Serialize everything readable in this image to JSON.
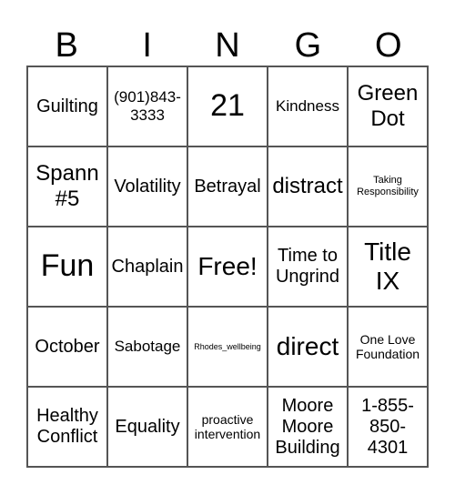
{
  "header": [
    "B",
    "I",
    "N",
    "G",
    "O"
  ],
  "cells": [
    {
      "text": "Guilting",
      "size": "s-m"
    },
    {
      "text": "(901)843-3333",
      "size": "s-sm"
    },
    {
      "text": "21",
      "size": "s-xl"
    },
    {
      "text": "Kindness",
      "size": "s-sm"
    },
    {
      "text": "Green Dot",
      "size": "s-ml"
    },
    {
      "text": "Spann #5",
      "size": "s-ml"
    },
    {
      "text": "Volatility",
      "size": "s-m"
    },
    {
      "text": "Betrayal",
      "size": "s-m"
    },
    {
      "text": "distract",
      "size": "s-ml"
    },
    {
      "text": "Taking Responsibility",
      "size": "s-xxs"
    },
    {
      "text": "Fun",
      "size": "s-xl"
    },
    {
      "text": "Chaplain",
      "size": "s-m"
    },
    {
      "text": "Free!",
      "size": "s-l"
    },
    {
      "text": "Time to Ungrind",
      "size": "s-m"
    },
    {
      "text": "Title IX",
      "size": "s-l"
    },
    {
      "text": "October",
      "size": "s-m"
    },
    {
      "text": "Sabotage",
      "size": "s-sm"
    },
    {
      "text": "Rhodes_wellbeing",
      "size": "s-tiny"
    },
    {
      "text": "direct",
      "size": "s-l"
    },
    {
      "text": "One Love Foundation",
      "size": "s-xs"
    },
    {
      "text": "Healthy Conflict",
      "size": "s-m"
    },
    {
      "text": "Equality",
      "size": "s-m"
    },
    {
      "text": "proactive intervention",
      "size": "s-xs"
    },
    {
      "text": "Moore Moore Building",
      "size": "s-m"
    },
    {
      "text": "1-855-850-4301",
      "size": "s-m"
    }
  ]
}
